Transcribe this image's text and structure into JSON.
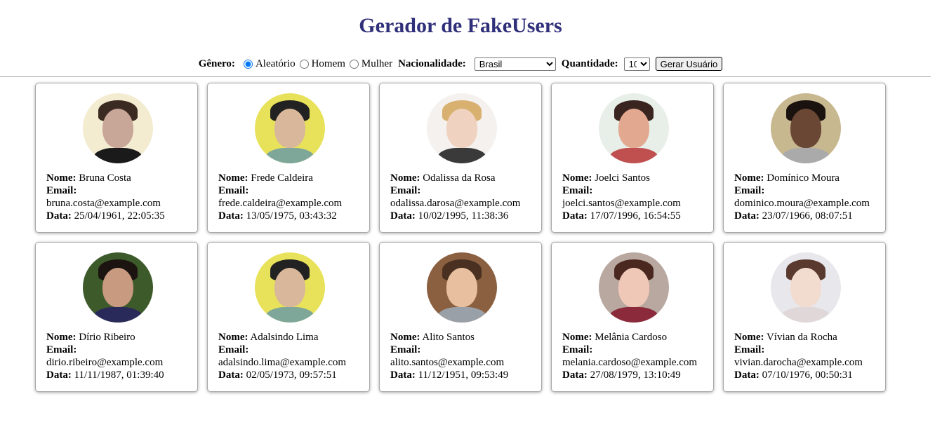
{
  "page": {
    "title": "Gerador de FakeUsers"
  },
  "controls": {
    "gender_label": "Gênero:",
    "gender_options": [
      "Aleatório",
      "Homem",
      "Mulher"
    ],
    "gender_selected": "Aleatório",
    "nationality_label": "Nacionalidade:",
    "nationality_value": "Brasil",
    "quantity_label": "Quantidade:",
    "quantity_value": "10",
    "generate_button": "Gerar Usuário"
  },
  "labels": {
    "name": "Nome:",
    "email": "Email:",
    "date": "Data:"
  },
  "users": [
    {
      "name": "Bruna Costa",
      "email": "bruna.costa@example.com",
      "date": "25/04/1961, 22:05:35",
      "avatar": {
        "bg": "#f3ecd0",
        "hair": "#3a2a22",
        "skin": "#c8a698",
        "body": "#1a1a1a"
      }
    },
    {
      "name": "Frede Caldeira",
      "email": "frede.caldeira@example.com",
      "date": "13/05/1975, 03:43:32",
      "avatar": {
        "bg": "#e8e25a",
        "hair": "#222222",
        "skin": "#d9b79a",
        "body": "#7ea79a"
      }
    },
    {
      "name": "Odalissa da Rosa",
      "email": "odalissa.darosa@example.com",
      "date": "10/02/1995, 11:38:36",
      "avatar": {
        "bg": "#f4f1ee",
        "hair": "#d8b070",
        "skin": "#f0d2c0",
        "body": "#3a3a3a"
      }
    },
    {
      "name": "Joelci Santos",
      "email": "joelci.santos@example.com",
      "date": "17/07/1996, 16:54:55",
      "avatar": {
        "bg": "#e8efe8",
        "hair": "#3a2420",
        "skin": "#e2a890",
        "body": "#c05050"
      }
    },
    {
      "name": "Domínico Moura",
      "email": "dominico.moura@example.com",
      "date": "23/07/1966, 08:07:51",
      "avatar": {
        "bg": "#c8b890",
        "hair": "#1a120e",
        "skin": "#6a4634",
        "body": "#aaaaaa"
      }
    },
    {
      "name": "Dírio Ribeiro",
      "email": "dirio.ribeiro@example.com",
      "date": "11/11/1987, 01:39:40",
      "avatar": {
        "bg": "#3d5a2a",
        "hair": "#1c1410",
        "skin": "#c89a80",
        "body": "#2a2a5a"
      }
    },
    {
      "name": "Adalsindo Lima",
      "email": "adalsindo.lima@example.com",
      "date": "02/05/1973, 09:57:51",
      "avatar": {
        "bg": "#e8e25a",
        "hair": "#222222",
        "skin": "#d9b79a",
        "body": "#7ea79a"
      }
    },
    {
      "name": "Alito Santos",
      "email": "alito.santos@example.com",
      "date": "11/12/1951, 09:53:49",
      "avatar": {
        "bg": "#8a6040",
        "hair": "#4a3020",
        "skin": "#e8c0a0",
        "body": "#9aa0a8"
      }
    },
    {
      "name": "Melânia Cardoso",
      "email": "melania.cardoso@example.com",
      "date": "27/08/1979, 13:10:49",
      "avatar": {
        "bg": "#b8a8a0",
        "hair": "#4a2820",
        "skin": "#f0c8b8",
        "body": "#8a2a3a"
      }
    },
    {
      "name": "Vívian da Rocha",
      "email": "vivian.darocha@example.com",
      "date": "07/10/1976, 00:50:31",
      "avatar": {
        "bg": "#e8e8ec",
        "hair": "#5a3a2e",
        "skin": "#f2dcd0",
        "body": "#e0d8d8"
      }
    }
  ]
}
